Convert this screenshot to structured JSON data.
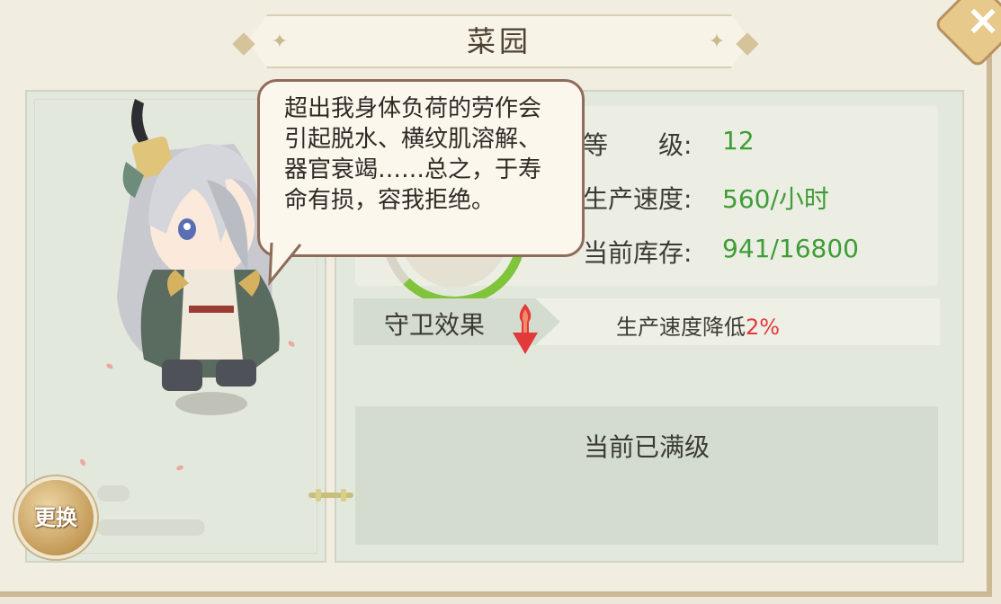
{
  "title": "菜园",
  "close_button": "×",
  "character": {
    "speech": "超出我身体负荷的劳作会引起脱水、横纹肌溶解、器官衰竭……总之，于寿命有损，容我拒绝。",
    "swap_label": "更换"
  },
  "stats": {
    "level_label": "等　　级:",
    "level_value": "12",
    "speed_label": "生产速度:",
    "speed_value": "560/小时",
    "stock_label": "当前库存:",
    "stock_value": "941/16800",
    "stock_progress": 0.056
  },
  "guard": {
    "label": "守卫效果",
    "effect_text": "生产速度降低",
    "effect_pct": "2%"
  },
  "status": {
    "max_level": "当前已满级"
  },
  "colors": {
    "value_green": "#3e9d36",
    "decrease_red": "#e23a3a",
    "panel_green": "#e3e8dc"
  }
}
